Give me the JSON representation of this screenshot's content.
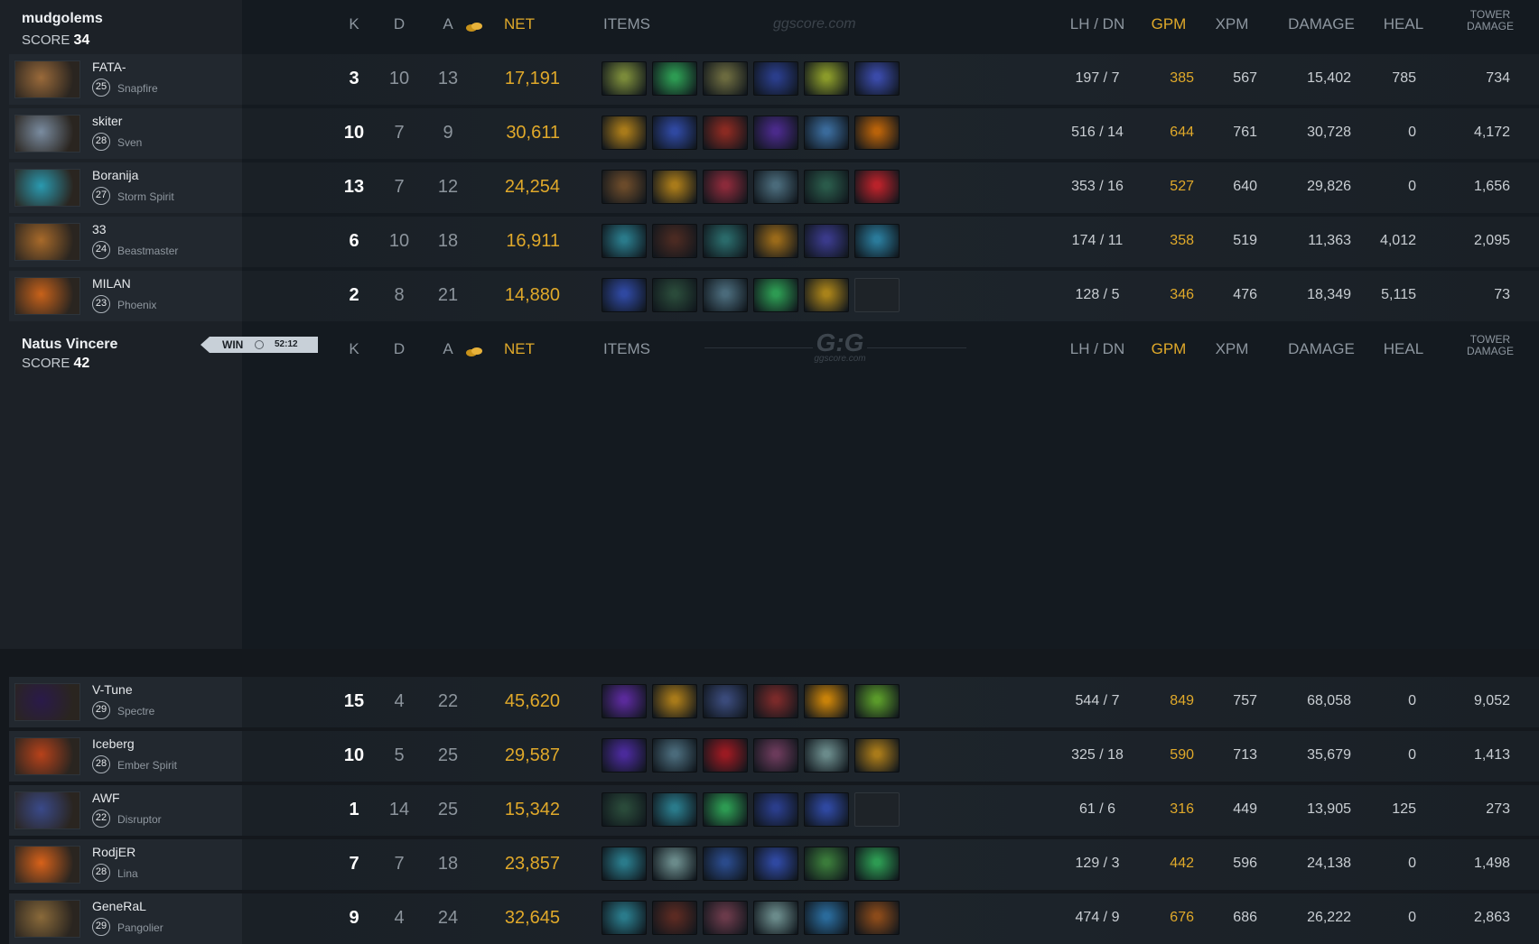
{
  "watermarks": {
    "top": "ggscore.com",
    "mid_logo": "G:G",
    "mid_sub": "ggscore.com"
  },
  "headers": {
    "k": "K",
    "d": "D",
    "a": "A",
    "net": "NET",
    "items": "ITEMS",
    "lhdn": "LH  /  DN",
    "gpm": "GPM",
    "xpm": "XPM",
    "damage": "DAMAGE",
    "heal": "HEAL",
    "tower1": "TOWER",
    "tower2": "DAMAGE"
  },
  "colors": {
    "gold": "#e0a92a",
    "panel": "#1c2127",
    "background": "#141a20"
  },
  "teams": [
    {
      "name": "mudgolems",
      "score_label": "SCORE",
      "score": "34",
      "players": [
        {
          "name": "FATA-",
          "level": "25",
          "hero": "Snapfire",
          "k": "3",
          "d": "10",
          "a": "13",
          "net": "17,191",
          "lhdn": "197  /  7",
          "gpm": "385",
          "xpm": "567",
          "damage": "15,402",
          "heal": "785",
          "tower": "734",
          "items": [
            "#7a8a3a",
            "#2d9a52",
            "#6b6a3f",
            "#2a3d8a",
            "#8a9a2a",
            "#3a4aa8"
          ]
        },
        {
          "name": "skiter",
          "level": "28",
          "hero": "Sven",
          "k": "10",
          "d": "7",
          "a": "9",
          "net": "30,611",
          "lhdn": "516  /  14",
          "gpm": "644",
          "xpm": "761",
          "damage": "30,728",
          "heal": "0",
          "tower": "4,172",
          "items": [
            "#a87a1a",
            "#2f48a0",
            "#8a2a22",
            "#4a2a8a",
            "#3a6a9a",
            "#b8620a"
          ]
        },
        {
          "name": "Boranija",
          "level": "27",
          "hero": "Storm Spirit",
          "k": "13",
          "d": "7",
          "a": "12",
          "net": "24,254",
          "lhdn": "353  /  16",
          "gpm": "527",
          "xpm": "640",
          "damage": "29,826",
          "heal": "0",
          "tower": "1,656",
          "items": [
            "#6a4a2a",
            "#a87a1a",
            "#8a2a3a",
            "#4a6a7a",
            "#2a5a4a",
            "#b8222a"
          ]
        },
        {
          "name": "33",
          "level": "24",
          "hero": "Beastmaster",
          "k": "6",
          "d": "10",
          "a": "18",
          "net": "16,911",
          "lhdn": "174  /  11",
          "gpm": "358",
          "xpm": "519",
          "damage": "11,363",
          "heal": "4,012",
          "tower": "2,095",
          "items": [
            "#2a7a8a",
            "#4a2a22",
            "#2a6a6a",
            "#9a6a1a",
            "#3a3a8a",
            "#2a7a9a"
          ]
        },
        {
          "name": "MILAN",
          "level": "23",
          "hero": "Phoenix",
          "k": "2",
          "d": "8",
          "a": "21",
          "net": "14,880",
          "lhdn": "128  /  5",
          "gpm": "346",
          "xpm": "476",
          "damage": "18,349",
          "heal": "5,115",
          "tower": "73",
          "items": [
            "#2f48a0",
            "#2a4a3a",
            "#4a6a7a",
            "#2d9a52",
            "#a8821a",
            ""
          ]
        }
      ]
    },
    {
      "name": "Natus Vincere",
      "score_label": "SCORE",
      "score": "42",
      "result": "WIN",
      "duration": "52:12",
      "players": [
        {
          "name": "V-Tune",
          "level": "29",
          "hero": "Spectre",
          "k": "15",
          "d": "4",
          "a": "22",
          "net": "45,620",
          "lhdn": "544  /  7",
          "gpm": "849",
          "xpm": "757",
          "damage": "68,058",
          "heal": "0",
          "tower": "9,052",
          "items": [
            "#5a2a9a",
            "#a87a1a",
            "#3a4a7a",
            "#7a2a2a",
            "#c8820a",
            "#5a9a2a"
          ]
        },
        {
          "name": "Iceberg",
          "level": "28",
          "hero": "Ember Spirit",
          "k": "10",
          "d": "5",
          "a": "25",
          "net": "29,587",
          "lhdn": "325  /  18",
          "gpm": "590",
          "xpm": "713",
          "damage": "35,679",
          "heal": "0",
          "tower": "1,413",
          "items": [
            "#4a2a9a",
            "#4a6a7a",
            "#9a1a22",
            "#6a3a5a",
            "#6a8a8a",
            "#a87a1a"
          ]
        },
        {
          "name": "AWF",
          "level": "22",
          "hero": "Disruptor",
          "k": "1",
          "d": "14",
          "a": "25",
          "net": "15,342",
          "lhdn": "61  /  6",
          "gpm": "316",
          "xpm": "449",
          "damage": "13,905",
          "heal": "125",
          "tower": "273",
          "items": [
            "#2a4a3a",
            "#2a7a8a",
            "#2d9a52",
            "#2a3d8a",
            "#2f48a0",
            ""
          ]
        },
        {
          "name": "RodjER",
          "level": "28",
          "hero": "Lina",
          "k": "7",
          "d": "7",
          "a": "18",
          "net": "23,857",
          "lhdn": "129  /  3",
          "gpm": "442",
          "xpm": "596",
          "damage": "24,138",
          "heal": "0",
          "tower": "1,498",
          "items": [
            "#2a7a8a",
            "#6a8a8a",
            "#2a4a8a",
            "#2f48a0",
            "#3a7a3a",
            "#2d9a52"
          ]
        },
        {
          "name": "GeneRaL",
          "level": "29",
          "hero": "Pangolier",
          "k": "9",
          "d": "4",
          "a": "24",
          "net": "32,645",
          "lhdn": "474  /  9",
          "gpm": "676",
          "xpm": "686",
          "damage": "26,222",
          "heal": "0",
          "tower": "2,863",
          "items": [
            "#2a7a8a",
            "#5a2a22",
            "#6a3a4a",
            "#6a8a8a",
            "#2a6a9a",
            "#8a4a1a"
          ]
        }
      ]
    }
  ]
}
